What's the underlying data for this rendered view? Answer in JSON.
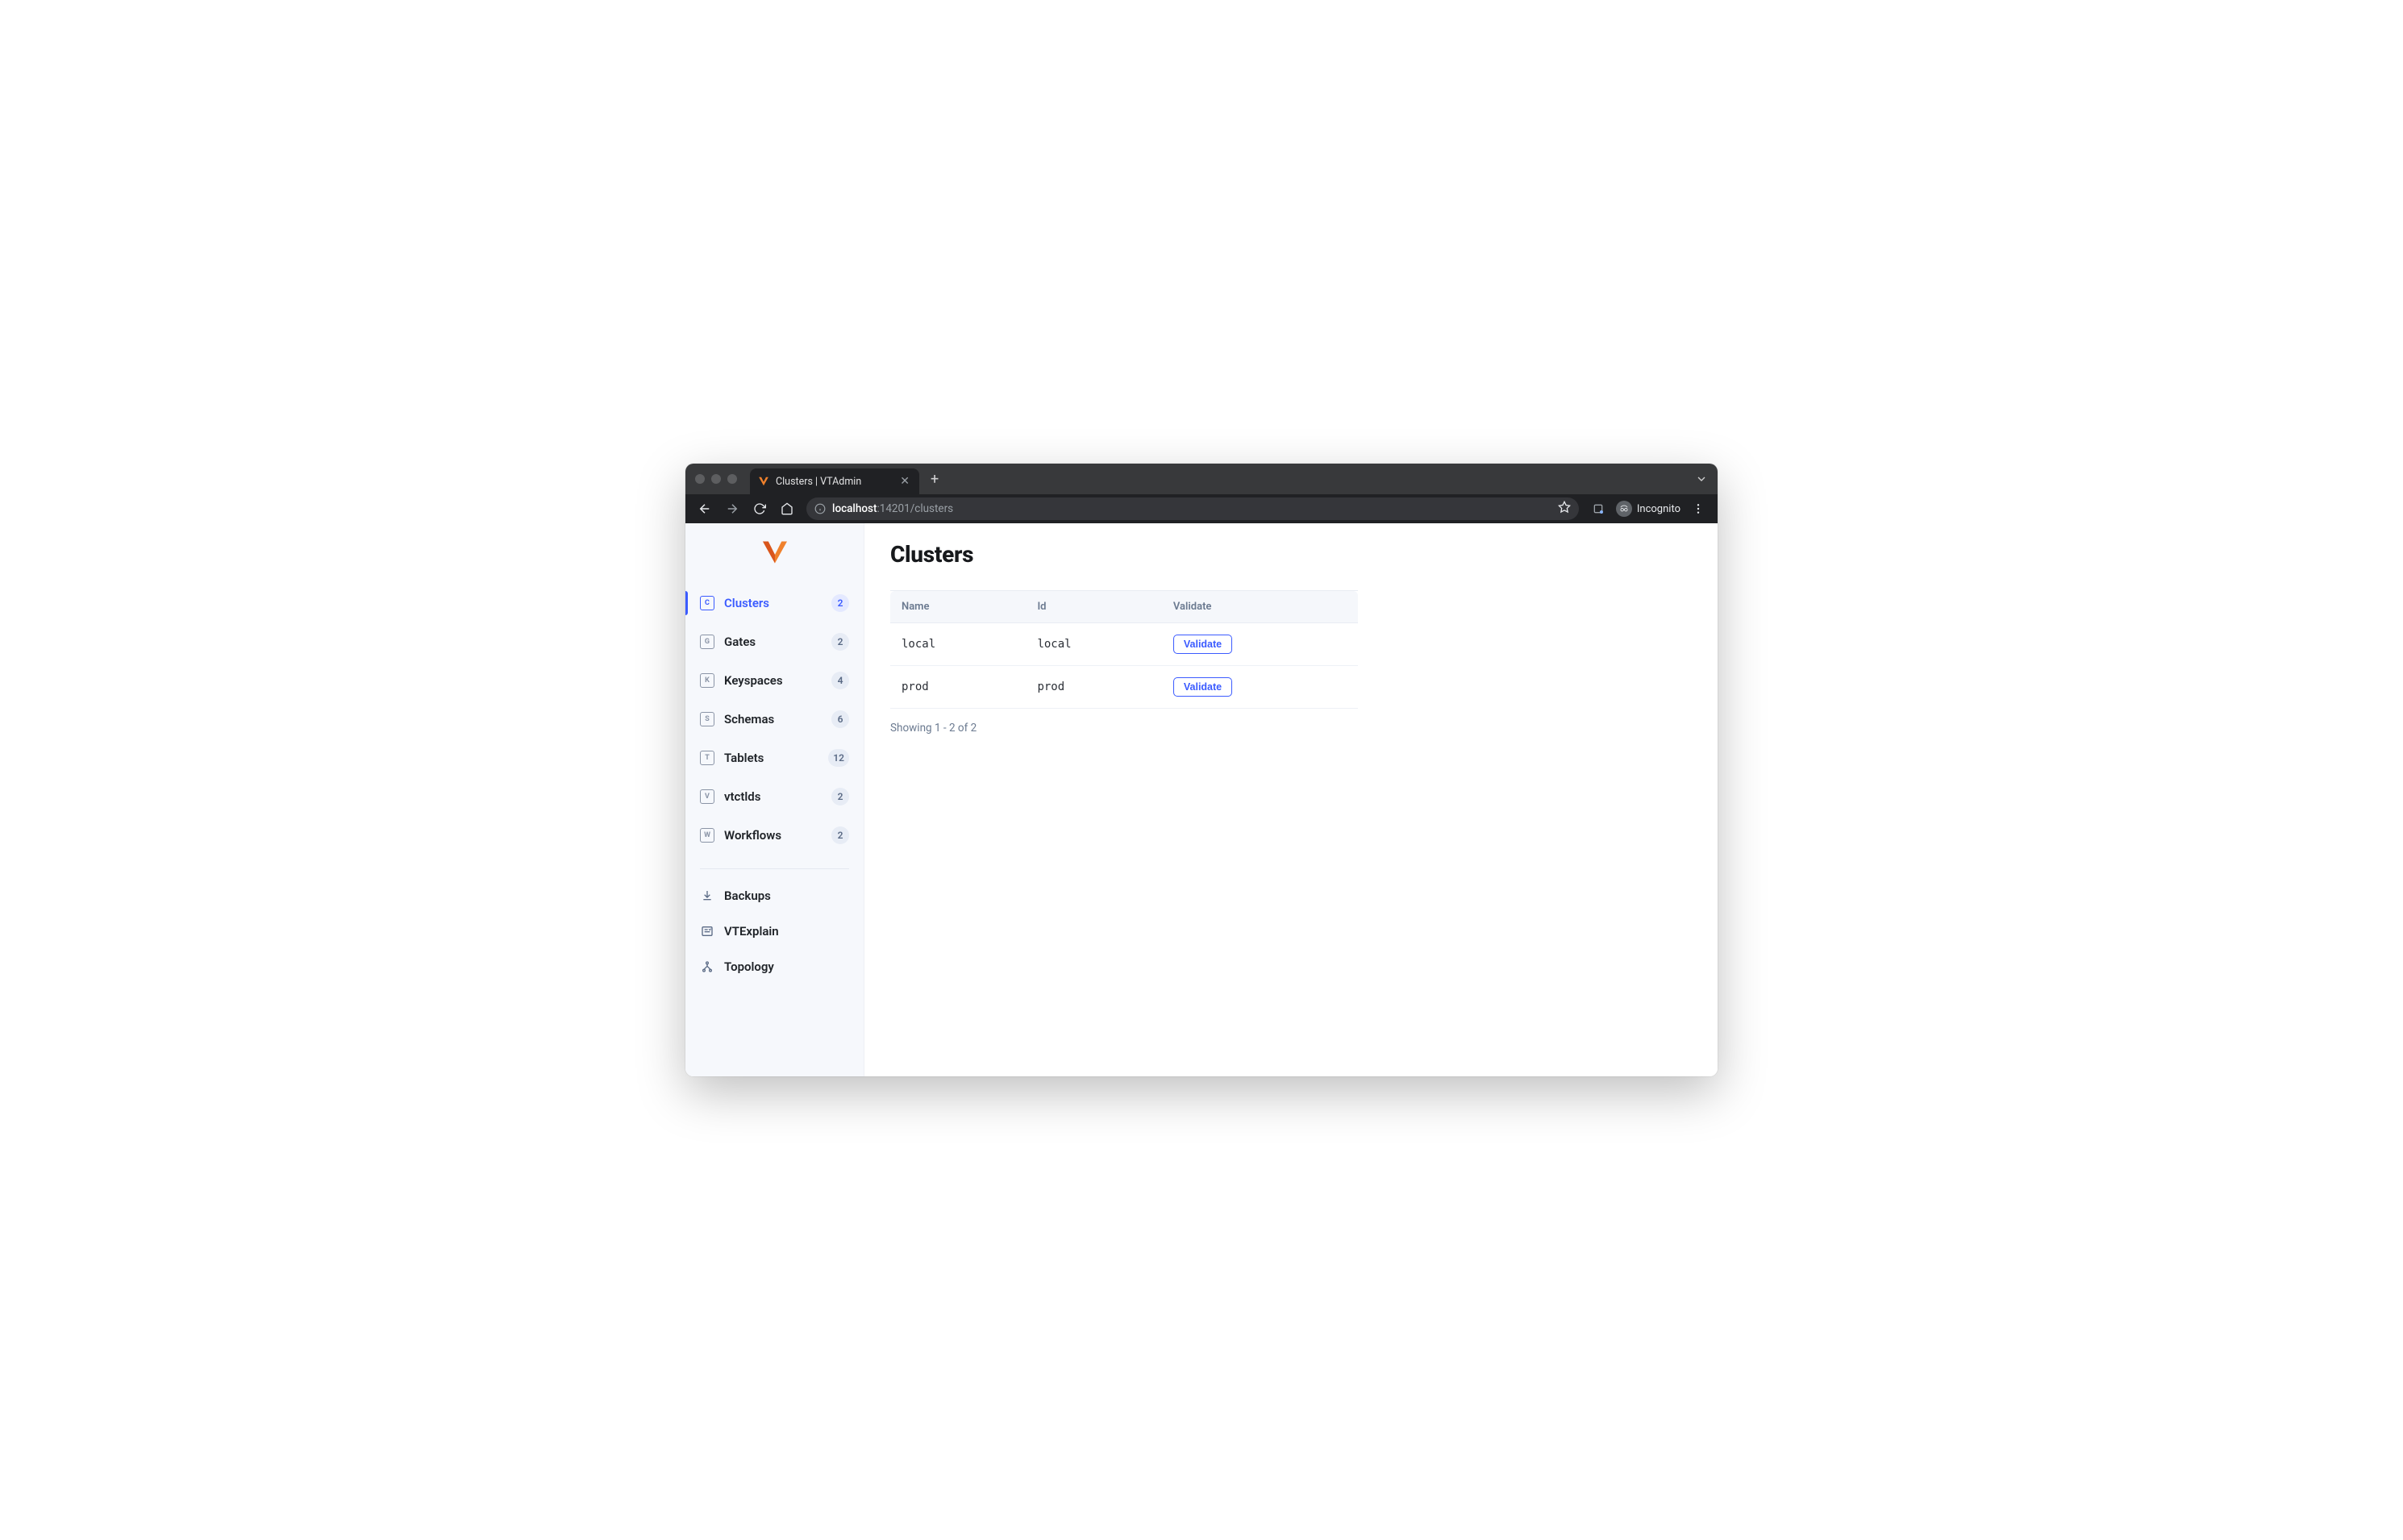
{
  "browser": {
    "tab_title": "Clusters | VTAdmin",
    "url_host": "localhost",
    "url_rest": ":14201/clusters",
    "incognito_label": "Incognito"
  },
  "sidebar": {
    "primary": [
      {
        "key": "C",
        "label": "Clusters",
        "count": "2",
        "active": true,
        "name": "sidebar-item-clusters"
      },
      {
        "key": "G",
        "label": "Gates",
        "count": "2",
        "active": false,
        "name": "sidebar-item-gates"
      },
      {
        "key": "K",
        "label": "Keyspaces",
        "count": "4",
        "active": false,
        "name": "sidebar-item-keyspaces"
      },
      {
        "key": "S",
        "label": "Schemas",
        "count": "6",
        "active": false,
        "name": "sidebar-item-schemas"
      },
      {
        "key": "T",
        "label": "Tablets",
        "count": "12",
        "active": false,
        "name": "sidebar-item-tablets"
      },
      {
        "key": "V",
        "label": "vtctlds",
        "count": "2",
        "active": false,
        "name": "sidebar-item-vtctlds"
      },
      {
        "key": "W",
        "label": "Workflows",
        "count": "2",
        "active": false,
        "name": "sidebar-item-workflows"
      }
    ],
    "secondary": [
      {
        "icon": "download-icon",
        "label": "Backups",
        "name": "sidebar-item-backups"
      },
      {
        "icon": "list-icon",
        "label": "VTExplain",
        "name": "sidebar-item-vtexplain"
      },
      {
        "icon": "tree-icon",
        "label": "Topology",
        "name": "sidebar-item-topology"
      }
    ]
  },
  "page": {
    "title": "Clusters",
    "columns": {
      "name": "Name",
      "id": "Id",
      "validate": "Validate"
    },
    "rows": [
      {
        "name": "local",
        "id": "local",
        "action": "Validate"
      },
      {
        "name": "prod",
        "id": "prod",
        "action": "Validate"
      }
    ],
    "pager": "Showing 1 - 2 of 2"
  }
}
